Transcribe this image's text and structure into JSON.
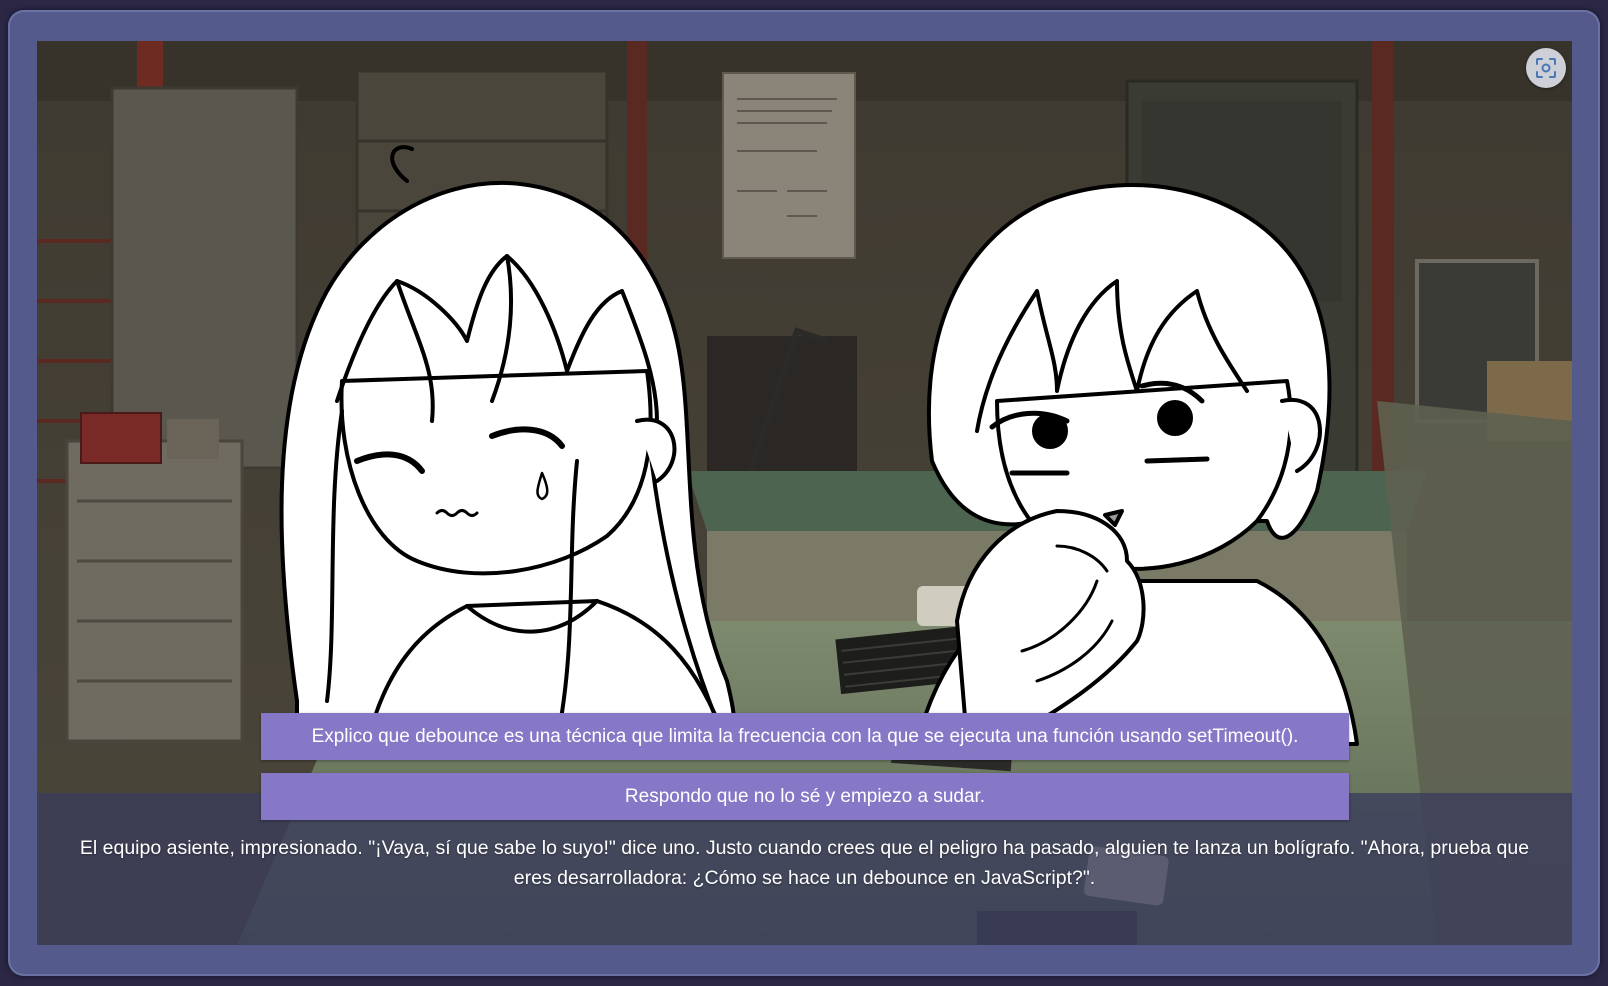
{
  "choices": [
    {
      "label": "Explico que debounce es una técnica que limita la frecuencia con la que se ejecuta una función usando setTimeout()."
    },
    {
      "label": "Respondo que no lo sé y empiezo a sudar."
    }
  ],
  "narration": "El equipo asiente, impresionado. \"¡Vaya, sí que sabe lo suyo!\" dice uno. Justo cuando crees que el peligro ha pasado, alguien te lanza un bolígrafo. \"Ahora, prueba que eres desarrolladora: ¿Cómo se hace un debounce en JavaScript?\".",
  "icons": {
    "fullscreen": "fullscreen-icon"
  },
  "colors": {
    "frame": "#545b8c",
    "choice_bg": "#8678c6",
    "textbox_bg": "#3a3c5c"
  }
}
